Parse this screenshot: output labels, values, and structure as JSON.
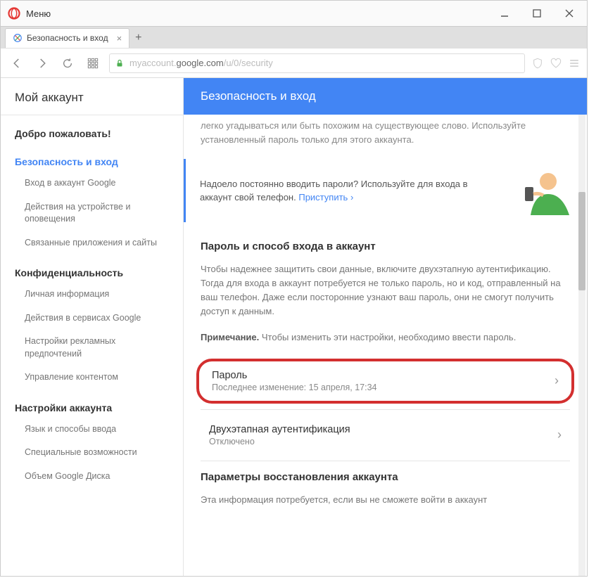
{
  "window": {
    "menu_label": "Меню"
  },
  "tab": {
    "title": "Безопасность и вход"
  },
  "urlbar": {
    "host": "myaccount.",
    "domain": "google.com",
    "path": "/u/0/security"
  },
  "sidebar": {
    "title": "Мой аккаунт",
    "welcome": "Добро пожаловать!",
    "security": "Безопасность и вход",
    "security_items": [
      "Вход в аккаунт Google",
      "Действия на устройстве и оповещения",
      "Связанные приложения и сайты"
    ],
    "privacy": "Конфиденциальность",
    "privacy_items": [
      "Личная информация",
      "Действия в сервисах Google",
      "Настройки рекламных предпочтений",
      "Управление контентом"
    ],
    "settings": "Настройки аккаунта",
    "settings_items": [
      "Язык и способы ввода",
      "Специальные возможности",
      "Объем Google Диска"
    ]
  },
  "main": {
    "title": "Безопасность и вход",
    "intro": "легко угадываться или быть похожим на существующее слово. Используйте установленный пароль только для этого аккаунта.",
    "promo_text": "Надоело постоянно вводить пароли? Используйте для входа в аккаунт свой телефон. ",
    "promo_link": "Приступить",
    "pw_section_title": "Пароль и способ входа в аккаунт",
    "pw_section_text": "Чтобы надежнее защитить свои данные, включите двухэтапную аутентификацию. Тогда для входа в аккаунт потребуется не только пароль, но и код, отправленный на ваш телефон. Даже если посторонние узнают ваш пароль, они не смогут получить доступ к данным.",
    "note_label": "Примечание.",
    "note_text": " Чтобы изменить эти настройки, необходимо ввести пароль.",
    "password_row_title": "Пароль",
    "password_row_sub": "Последнее изменение: 15 апреля, 17:34",
    "twostep_row_title": "Двухэтапная аутентификация",
    "twostep_row_sub": "Отключено",
    "recovery_title": "Параметры восстановления аккаунта",
    "recovery_text": "Эта информация потребуется, если вы не сможете войти в аккаунт"
  }
}
